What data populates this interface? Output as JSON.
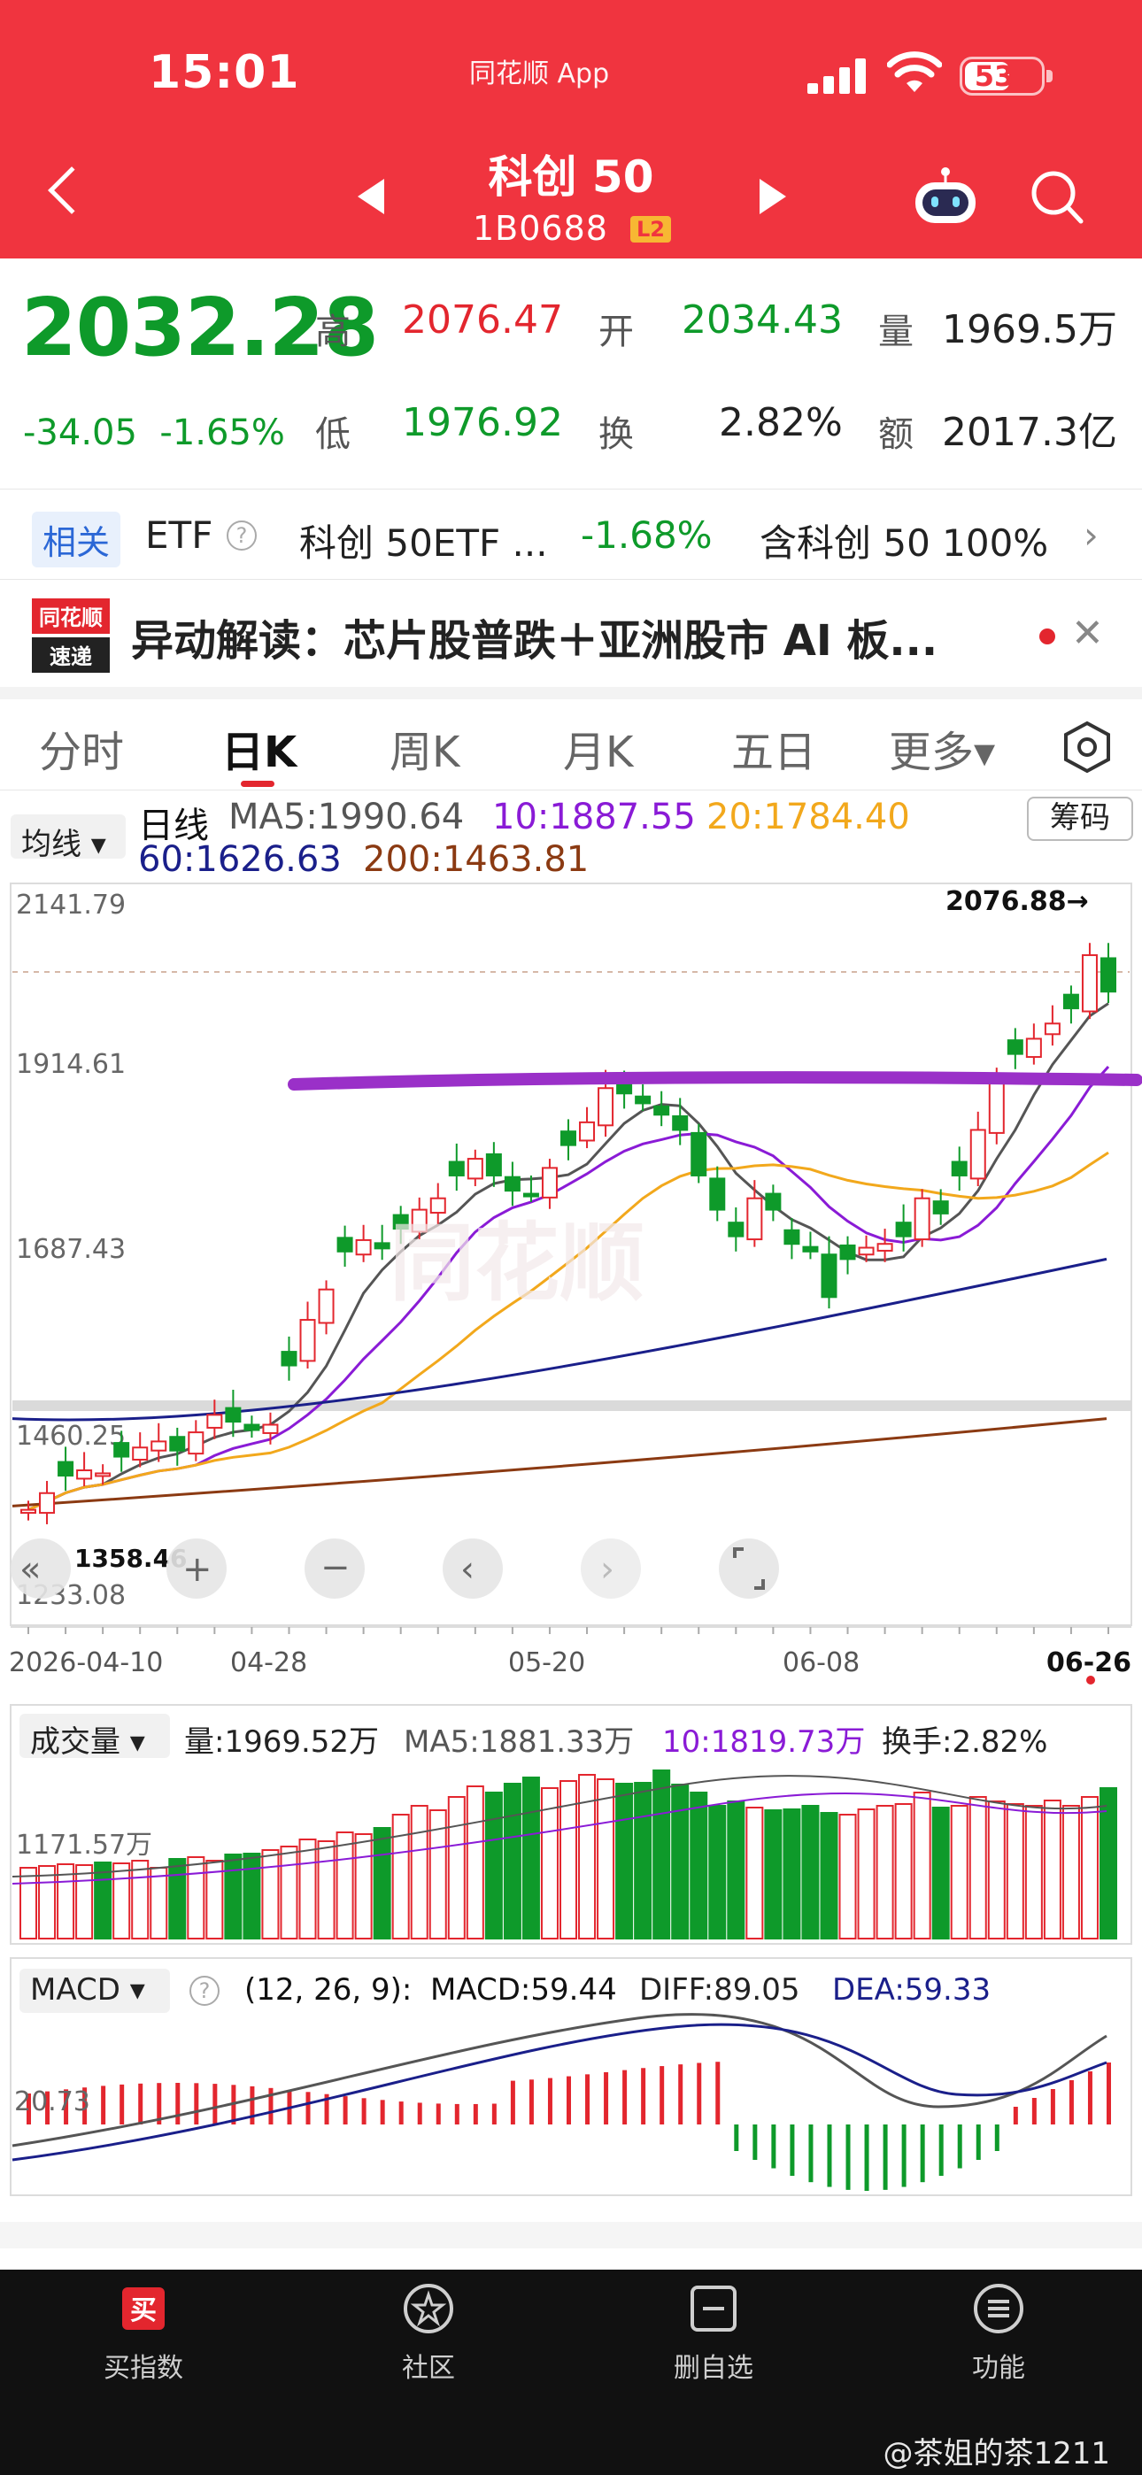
{
  "status": {
    "time": "15:01",
    "app_tag": "同花顺 App",
    "battery": "53"
  },
  "header": {
    "title": "科创 50",
    "code": "1B0688",
    "level": "L2"
  },
  "quote": {
    "price": "2032.28",
    "change": "-34.05",
    "change_pct": "-1.65%",
    "high_label": "高",
    "high": "2076.47",
    "open_label": "开",
    "open": "2034.43",
    "volume_label": "量",
    "volume": "1969.5万",
    "low_label": "低",
    "low": "1976.92",
    "turnover_label": "换",
    "turnover": "2.82%",
    "amount_label": "额",
    "amount": "2017.3亿"
  },
  "etf": {
    "tag": "相关",
    "label": "ETF",
    "name": "科创 50ETF ...",
    "pct": "-1.68%",
    "note": "含科创 50 100%"
  },
  "news": {
    "logo_top": "同花顺",
    "logo_bottom": "速递",
    "text": "异动解读：芯片股普跌＋亚洲股市 AI 板..."
  },
  "tabs": [
    "分时",
    "日K",
    "周K",
    "月K",
    "五日",
    "更多▾"
  ],
  "chart": {
    "ma_select": "均线 ▾",
    "period": "日线",
    "ma5": "MA5:1990.64",
    "ma10": "10:1887.55",
    "ma20": "20:1784.40",
    "ma60": "60:1626.63",
    "ma200": "200:1463.81",
    "chips": "筹码",
    "y_ticks": [
      "2141.79",
      "1914.61",
      "1687.43",
      "1460.25",
      "1233.08"
    ],
    "low_mark": "1358.46",
    "high_mark": "2076.88→",
    "x_ticks": [
      "2026-04-10",
      "04-28",
      "05-20",
      "06-08",
      "06-26"
    ],
    "colors": {
      "up": "#e3262e",
      "down": "#0e9a2a",
      "ma5": "#555555",
      "ma10": "#8a1bd6",
      "ma20": "#f2a81c",
      "ma60": "#1a1f8a",
      "ma200": "#8b3a12",
      "line": "#9a30c8"
    }
  },
  "volume": {
    "select": "成交量 ▾",
    "vol": "量:1969.52万",
    "ma5": "MA5:1881.33万",
    "ma10": "10:1819.73万",
    "turnover": "换手:2.82%",
    "tick": "1171.57万"
  },
  "macd": {
    "select": "MACD ▾",
    "params": "(12, 26, 9):",
    "macd": "MACD:59.44",
    "diff": "DIFF:89.05",
    "dea": "DEA:59.33",
    "tick": "20.73"
  },
  "nav": [
    {
      "label": "买指数",
      "icon": "buy-icon"
    },
    {
      "label": "社区",
      "icon": "community-icon"
    },
    {
      "label": "删自选",
      "icon": "remove-watch-icon"
    },
    {
      "label": "功能",
      "icon": "menu-icon"
    }
  ],
  "watermark": "@茶姐的茶1211"
}
